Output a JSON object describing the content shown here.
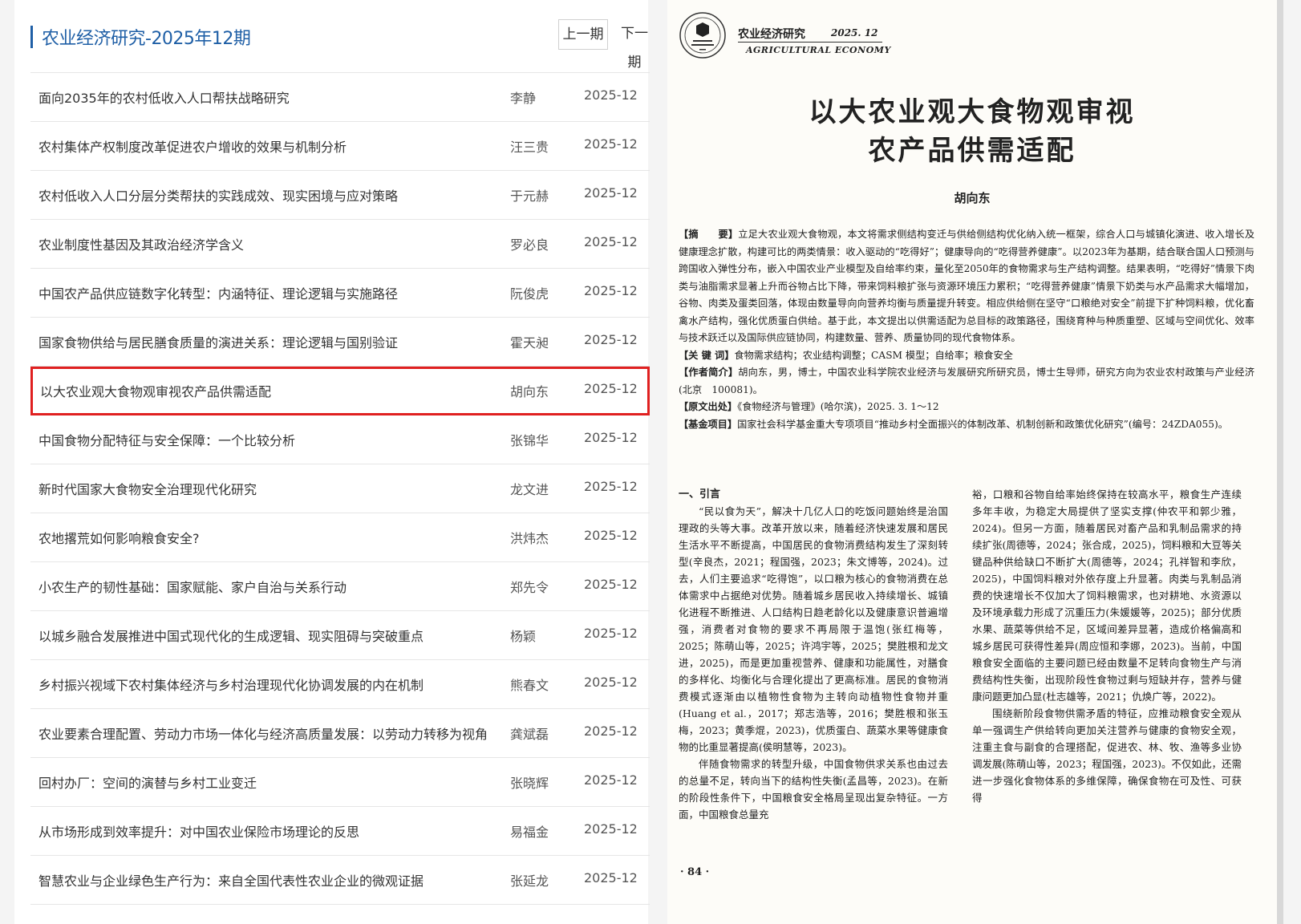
{
  "issue_title": "农业经济研究-2025年12期",
  "nav": {
    "prev": "上一期",
    "next": "下一期"
  },
  "articles": [
    {
      "title": "面向2035年的农村低收入人口帮扶战略研究",
      "author": "李静",
      "date": "2025-12"
    },
    {
      "title": "农村集体产权制度改革促进农户增收的效果与机制分析",
      "author": "汪三贵",
      "date": "2025-12"
    },
    {
      "title": "农村低收入人口分层分类帮扶的实践成效、现实困境与应对策略",
      "author": "于元赫",
      "date": "2025-12"
    },
    {
      "title": "农业制度性基因及其政治经济学含义",
      "author": "罗必良",
      "date": "2025-12"
    },
    {
      "title": "中国农产品供应链数字化转型：内涵特征、理论逻辑与实施路径",
      "author": "阮俊虎",
      "date": "2025-12"
    },
    {
      "title": "国家食物供给与居民膳食质量的演进关系：理论逻辑与国别验证",
      "author": "霍天昶",
      "date": "2025-12"
    },
    {
      "title": "以大农业观大食物观审视农产品供需适配",
      "author": "胡向东",
      "date": "2025-12"
    },
    {
      "title": "中国食物分配特征与安全保障：一个比较分析",
      "author": "张锦华",
      "date": "2025-12"
    },
    {
      "title": "新时代国家大食物安全治理现代化研究",
      "author": "龙文进",
      "date": "2025-12"
    },
    {
      "title": "农地撂荒如何影响粮食安全?",
      "author": "洪炜杰",
      "date": "2025-12"
    },
    {
      "title": "小农生产的韧性基础：国家赋能、家户自治与关系行动",
      "author": "郑先令",
      "date": "2025-12"
    },
    {
      "title": "以城乡融合发展推进中国式现代化的生成逻辑、现实阻碍与突破重点",
      "author": "杨颖",
      "date": "2025-12"
    },
    {
      "title": "乡村振兴视域下农村集体经济与乡村治理现代化协调发展的内在机制",
      "author": "熊春文",
      "date": "2025-12"
    },
    {
      "title": "农业要素合理配置、劳动力市场一体化与经济高质量发展：以劳动力转移为视角",
      "author": "龚斌磊",
      "date": "2025-12"
    },
    {
      "title": "回村办厂：空间的演替与乡村工业变迁",
      "author": "张晓辉",
      "date": "2025-12"
    },
    {
      "title": "从市场形成到效率提升：对中国农业保险市场理论的反思",
      "author": "易福金",
      "date": "2025-12"
    },
    {
      "title": "智慧农业与企业绿色生产行为：来自全国代表性农业企业的微观证据",
      "author": "张延龙",
      "date": "2025-12"
    }
  ],
  "selected_index": 6,
  "paper": {
    "journal_cn": "农业经济研究",
    "journal_issue": "2025. 12",
    "journal_en": "AGRICULTURAL  ECONOMY",
    "title_line1": "以大农业观大食物观审视",
    "title_line2": "农产品供需适配",
    "author": "胡向东",
    "abstract_label": "【摘　　要】",
    "abstract": "立足大农业观大食物观，本文将需求侧结构变迁与供给侧结构优化纳入统一框架，综合人口与城镇化演进、收入增长及健康理念扩散，构建可比的两类情景：收入驱动的“吃得好”；健康导向的“吃得营养健康”。以2023年为基期，结合联合国人口预测与跨国收入弹性分布，嵌入中国农业产业模型及自给率约束，量化至2050年的食物需求与生产结构调整。结果表明，“吃得好”情景下肉类与油脂需求显著上升而谷物占比下降，带来饲料粮扩张与资源环境压力累积；“吃得营养健康”情景下奶类与水产品需求大幅增加，谷物、肉类及蛋类回落，体现由数量导向向营养均衡与质量提升转变。相应供给侧在坚守“口粮绝对安全”前提下扩种饲料粮，优化畜禽水产结构，强化优质蛋白供给。基于此，本文提出以供需适配为总目标的政策路径，围绕育种与种质重塑、区域与空间优化、效率与技术跃迁以及国际供应链协同，构建数量、营养、质量协同的现代食物体系。",
    "keywords_label": "【关 键 词】",
    "keywords": "食物需求结构；农业结构调整；CASM 模型；自给率；粮食安全",
    "bio_label": "【作者简介】",
    "bio": "胡向东，男，博士，中国农业科学院农业经济与发展研究所研究员，博士生导师，研究方向为农业农村政策与产业经济(北京　100081)。",
    "source_label": "【原文出处】",
    "source": "《食物经济与管理》(哈尔滨)，2025. 3. 1～12",
    "fund_label": "【基金项目】",
    "fund": "国家社会科学基金重大专项项目“推动乡村全面振兴的体制改革、机制创新和政策优化研究”(编号：24ZDA055)。",
    "section_head": "一、引言",
    "col1_p1": "“民以食为天”，解决十几亿人口的吃饭问题始终是治国理政的头等大事。改革开放以来，随着经济快速发展和居民生活水平不断提高，中国居民的食物消费结构发生了深刻转型(辛良杰，2021；程国强，2023；朱文博等，2024)。过去，人们主要追求“吃得饱”，以口粮为核心的食物消费在总体需求中占据绝对优势。随着城乡居民收入持续增长、城镇化进程不断推进、人口结构日趋老龄化以及健康意识普遍增强，消费者对食物的要求不再局限于温饱(张红梅等，2025；陈萌山等，2025；许鸿宇等，2025；樊胜根和龙文进，2025)，而是更加重视营养、健康和功能属性，对膳食的多样化、均衡化与合理化提出了更高标准。居民的食物消费模式逐渐由以植物性食物为主转向动植物性食物并重(Huang et al.，2017；郑志浩等，2016；樊胜根和张玉梅，2023；黄季焜，2023)，优质蛋白、蔬菜水果等健康食物的比重显著提高(侯明慧等，2023)。",
    "col1_p2": "伴随食物需求的转型升级，中国食物供求关系也由过去的总量不足，转向当下的结构性失衡(孟昌等，2023)。在新的阶段性条件下，中国粮食安全格局呈现出复杂特征。一方面，中国粮食总量充",
    "col2_p1": "裕，口粮和谷物自给率始终保持在较高水平，粮食生产连续多年丰收，为稳定大局提供了坚实支撑(仲农平和郭少雅，2024)。但另一方面，随着居民对畜产品和乳制品需求的持续扩张(周德等，2024；张合成，2025)，饲料粮和大豆等关键品种供给缺口不断扩大(周德等，2024；孔祥智和李欣，2025)，中国饲料粮对外依存度上升显著。肉类与乳制品消费的快速增长不仅加大了饲料粮需求，也对耕地、水资源以及环境承载力形成了沉重压力(朱媛媛等，2025)；部分优质水果、蔬菜等供给不足，区域间差异显著，造成价格偏高和城乡居民可获得性差异(周应恒和李娜，2023)。当前，中国粮食安全面临的主要问题已经由数量不足转向食物生产与消费结构性失衡，出现阶段性食物过剩与短缺并存，营养与健康问题更加凸显(杜志雄等，2021；仇焕广等，2022)。",
    "col2_p2": "围绕新阶段食物供需矛盾的特征，应推动粮食安全观从单一强调生产供给转向更加关注营养与健康的食物安全观，注重主食与副食的合理搭配，促进农、林、牧、渔等多业协调发展(陈萌山等，2023；程国强，2023)。不仅如此，还需进一步强化食物体系的多维保障，确保食物在可及性、可获得",
    "page_number": "· 84 ·"
  }
}
